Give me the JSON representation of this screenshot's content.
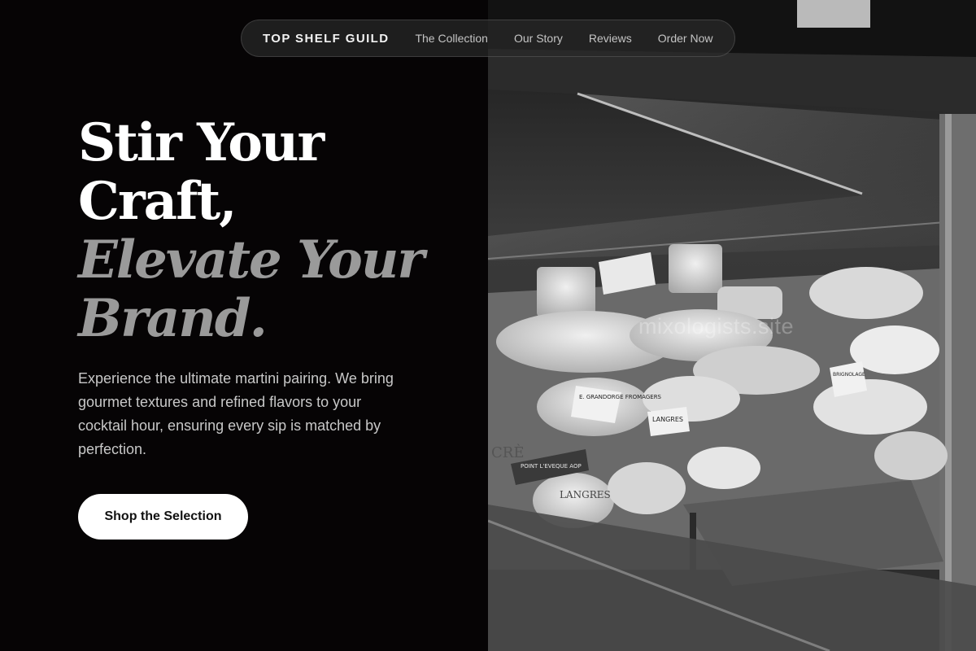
{
  "nav": {
    "brand": "TOP SHELF GUILD",
    "links": [
      "The Collection",
      "Our Story",
      "Reviews",
      "Order Now"
    ]
  },
  "hero": {
    "title_line1": "Stir Your",
    "title_line2": "Craft,",
    "title_accent_line1": "Elevate Your",
    "title_accent_line2": "Brand.",
    "description": "Experience the ultimate martini pairing. We bring gourmet textures and refined flavors to your cocktail hour, ensuring every sip is matched by perfection.",
    "cta_label": "Shop the Selection"
  },
  "image": {
    "watermark": "mixologists.site",
    "labels": [
      "E. GRANDORGE FROMAGERS",
      "LANGRES",
      "LANGRES",
      "POINT L'EVEQUE AOP",
      "CRÈ",
      "BRIGNOLAGE"
    ]
  },
  "colors": {
    "background": "#060405",
    "accent_text": "#9a9a9a",
    "cta_background": "#ffffff"
  }
}
